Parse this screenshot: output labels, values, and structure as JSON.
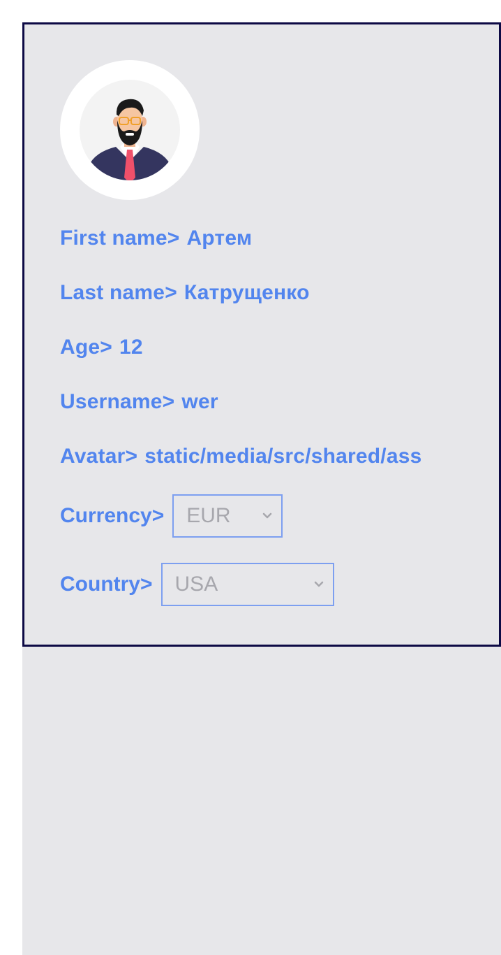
{
  "profile": {
    "first_name_label": "First name>",
    "first_name_value": "Артем",
    "last_name_label": "Last name>",
    "last_name_value": "Катрущенко",
    "age_label": "Age>",
    "age_value": "12",
    "username_label": "Username>",
    "username_value": "wer",
    "avatar_label": "Avatar>",
    "avatar_value": "static/media/src/shared/ass",
    "currency_label": "Currency>",
    "currency_selected": "EUR",
    "country_label": "Country>",
    "country_selected": "USA"
  },
  "icons": {
    "avatar": "man-with-beard-avatar",
    "dropdown": "chevron-down-icon"
  },
  "colors": {
    "label_text": "#5285ee",
    "card_border": "#0d0a45",
    "background": "#e7e7ea",
    "select_border": "#7d9ff0",
    "select_text": "#a7a7ad"
  }
}
